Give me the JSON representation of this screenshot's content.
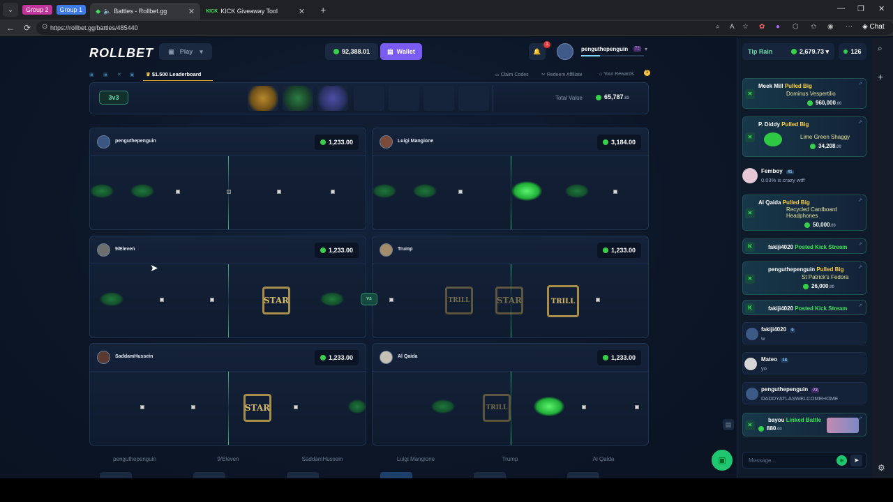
{
  "browser": {
    "groups": [
      "Group 2",
      "Group 1"
    ],
    "tabs": [
      {
        "title": "Battles - Rollbet.gg"
      },
      {
        "title": "KICK Giveaway Tool"
      }
    ],
    "url": "https://rollbet.gg/battles/485440",
    "chat_label": "Chat",
    "new_tab": "+"
  },
  "header": {
    "logo": "ROLLBET",
    "play_label": "Play",
    "balance": "92,388.01",
    "wallet_label": "Wallet",
    "notif_count": "1",
    "username": "penguthepenguin",
    "user_level": "72"
  },
  "subnav": {
    "leaderboard": "$1.500 Leaderboard",
    "claim_codes": "Claim Codes",
    "redeem_affiliate": "Redeem Affiliate",
    "your_rewards": "Your Rewards",
    "rewards_badge": "1"
  },
  "battle": {
    "mode": "3v3",
    "total_value_label": "Total Value",
    "total_value": "65,787",
    "total_value_cents": ".83",
    "vs": "vs"
  },
  "players": [
    {
      "name": "penguthepenguin",
      "value": "1,233.00"
    },
    {
      "name": "Luigi Mangione",
      "value": "3,184.00"
    },
    {
      "name": "9/Eleven",
      "value": "1,233.00"
    },
    {
      "name": "Trump",
      "value": "1,233.00"
    },
    {
      "name": "SaddamHussein",
      "value": "1,233.00"
    },
    {
      "name": "Al Qaida",
      "value": "1,233.00"
    }
  ],
  "footer_names": [
    "penguthepenguin",
    "9/Eleven",
    "SaddamHussein",
    "Luigi Mangione",
    "Trump",
    "Al Qaida"
  ],
  "items": {
    "star": "STAR",
    "trill": "TRILL"
  },
  "chat": {
    "tip_rain": "Tip Rain",
    "rain_amount": "2,679.73",
    "online": "126",
    "messages": [
      {
        "user": "Meek Mill",
        "tag": "Pulled Big",
        "item": "Dominus Vespertilio",
        "value": "960,000",
        "cents": ".00"
      },
      {
        "user": "P. Diddy",
        "tag": "Pulled Big",
        "item": "Lime Green Shaggy",
        "value": "34,208",
        "cents": ".00"
      },
      {
        "user": "Femboy",
        "level": "41",
        "text": "0.03% is crazy wtff"
      },
      {
        "user": "Al Qaida",
        "tag": "Pulled Big",
        "item": "Recycled Cardboard Headphones",
        "value": "50,000",
        "cents": ".00"
      },
      {
        "user": "fakiji4020",
        "tag": "Posted Kick Stream"
      },
      {
        "user": "penguthepenguin",
        "tag": "Pulled Big",
        "item": "St Patrick's Fedora",
        "value": "26,000",
        "cents": ".00"
      },
      {
        "user": "fakiji4020",
        "tag": "Posted Kick Stream"
      },
      {
        "user": "fakiji4020",
        "level": "9",
        "text": "w"
      },
      {
        "user": "Mateo",
        "level": "18",
        "text": "yo"
      },
      {
        "user": "penguthepenguin",
        "level": "72",
        "text": "DADDYATLASWELCOMEHOME"
      },
      {
        "user": "bayou",
        "tag": "Linked Battle",
        "value": "880",
        "cents": ".00"
      }
    ],
    "input_placeholder": "Message..."
  }
}
